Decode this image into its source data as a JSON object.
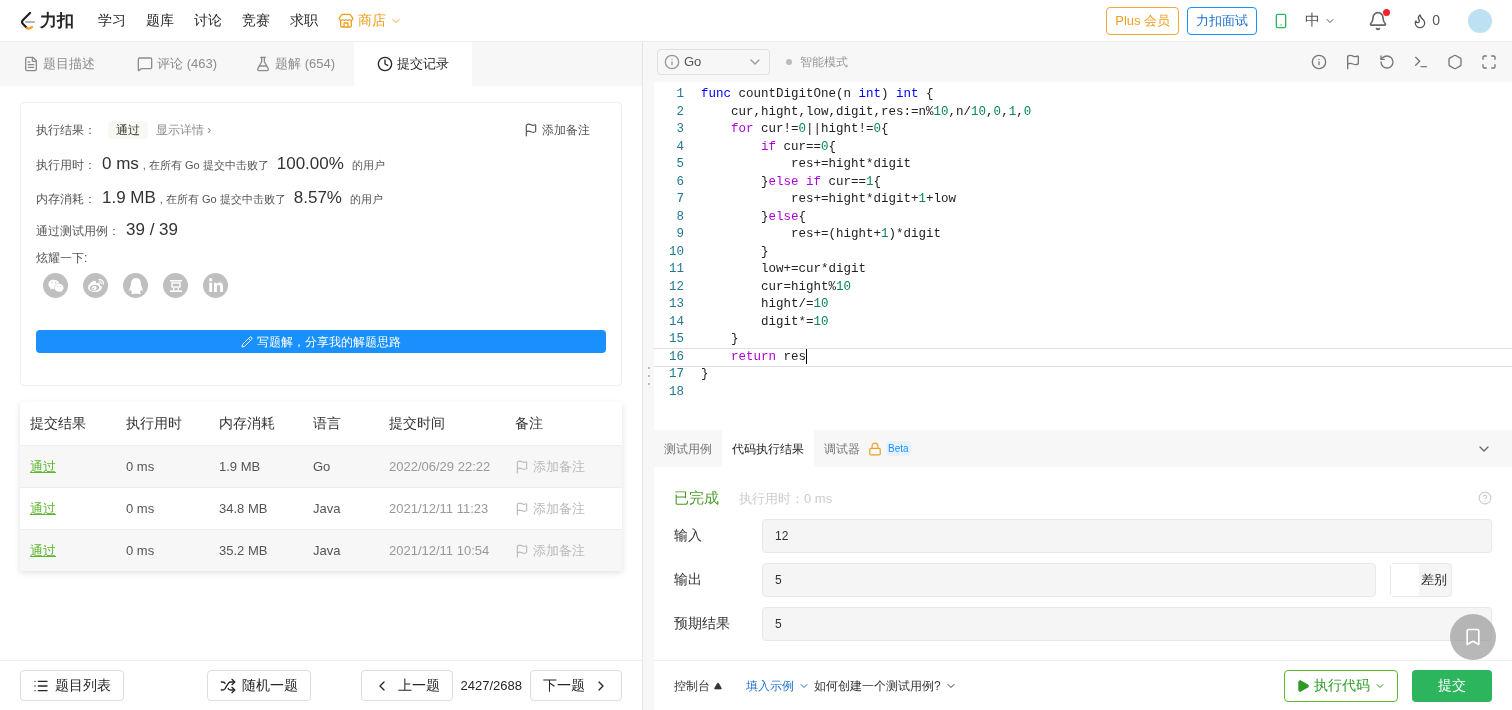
{
  "nav": {
    "logo": "力扣",
    "items": [
      {
        "label": "学习",
        "kind": "link"
      },
      {
        "label": "题库",
        "kind": "link"
      },
      {
        "label": "讨论",
        "kind": "link"
      },
      {
        "label": "竞赛",
        "kind": "link"
      },
      {
        "label": "求职",
        "kind": "link"
      },
      {
        "label": "商店",
        "kind": "store"
      }
    ],
    "plus": "Plus 会员",
    "interview": "力扣面试",
    "language": "中",
    "notification_dot": true,
    "points": "0"
  },
  "left_tabs": [
    {
      "label": "题目描述",
      "kind": "description",
      "selected": false
    },
    {
      "label": "评论 (463)",
      "kind": "comment",
      "selected": false
    },
    {
      "label": "题解 (654)",
      "kind": "solution",
      "selected": false
    },
    {
      "label": "提交记录",
      "kind": "history",
      "selected": true
    }
  ],
  "result_card": {
    "result_label": "执行结果：",
    "result": "通过",
    "details": "显示详情 ›",
    "add_note": "添加备注",
    "stats": [
      {
        "label": "执行用时：",
        "value": "0 ms",
        "middle": ", 在所有 Go 提交中击败了",
        "percent": "100.00%",
        "suffix": "的用户"
      },
      {
        "label": "内存消耗：",
        "value": "1.9 MB",
        "middle": ", 在所有 Go 提交中击败了",
        "percent": "8.57%",
        "suffix": "的用户"
      }
    ],
    "cases_label": "通过测试用例：",
    "cases": "39 / 39",
    "share_label": "炫耀一下:",
    "share": [
      {
        "kind": "wechat"
      },
      {
        "kind": "weibo"
      },
      {
        "kind": "qq"
      },
      {
        "kind": "douban"
      },
      {
        "kind": "linkedin"
      }
    ],
    "write_button": "写题解，分享我的解题思路"
  },
  "table": {
    "columns": [
      "提交结果",
      "执行用时",
      "内存消耗",
      "语言",
      "提交时间",
      "备注"
    ],
    "rows": [
      {
        "cells": [
          "通过",
          "0 ms",
          "1.9 MB",
          "Go",
          "2022/06/29 22:22"
        ],
        "note": "添加备注"
      },
      {
        "cells": [
          "通过",
          "0 ms",
          "34.8 MB",
          "Java",
          "2021/12/11 11:23"
        ],
        "note": "添加备注"
      },
      {
        "cells": [
          "通过",
          "0 ms",
          "35.2 MB",
          "Java",
          "2021/12/11 10:54"
        ],
        "note": "添加备注"
      }
    ]
  },
  "footer_left": {
    "list": "题目列表",
    "random": "随机一题",
    "prev": "上一题",
    "counter": "2427/2688",
    "next": "下一题"
  },
  "editor": {
    "language": "Go",
    "smart_mode": "智能模式",
    "lines": [
      {
        "number": "1",
        "current": false,
        "tokens": [
          {
            "kind": "kw",
            "text": "func"
          },
          {
            "kind": "plain",
            "text": " countDigitOne(n "
          },
          {
            "kind": "kw",
            "text": "int"
          },
          {
            "kind": "plain",
            "text": ") "
          },
          {
            "kind": "kw",
            "text": "int"
          },
          {
            "kind": "plain",
            "text": " {"
          }
        ]
      },
      {
        "number": "2",
        "current": false,
        "tokens": [
          {
            "kind": "plain",
            "text": "    cur,hight,low,digit,res:=n%"
          },
          {
            "kind": "num",
            "text": "10"
          },
          {
            "kind": "plain",
            "text": ",n/"
          },
          {
            "kind": "num",
            "text": "10"
          },
          {
            "kind": "plain",
            "text": ","
          },
          {
            "kind": "num",
            "text": "0"
          },
          {
            "kind": "plain",
            "text": ","
          },
          {
            "kind": "num",
            "text": "1"
          },
          {
            "kind": "plain",
            "text": ","
          },
          {
            "kind": "num",
            "text": "0"
          }
        ]
      },
      {
        "number": "3",
        "current": false,
        "tokens": [
          {
            "kind": "ctrl",
            "text": "    for"
          },
          {
            "kind": "plain",
            "text": " cur!="
          },
          {
            "kind": "num",
            "text": "0"
          },
          {
            "kind": "plain",
            "text": "||hight!="
          },
          {
            "kind": "num",
            "text": "0"
          },
          {
            "kind": "plain",
            "text": "{"
          }
        ]
      },
      {
        "number": "4",
        "current": false,
        "tokens": [
          {
            "kind": "ctrl",
            "text": "        if"
          },
          {
            "kind": "plain",
            "text": " cur=="
          },
          {
            "kind": "num",
            "text": "0"
          },
          {
            "kind": "plain",
            "text": "{"
          }
        ]
      },
      {
        "number": "5",
        "current": false,
        "tokens": [
          {
            "kind": "plain",
            "text": "            res+=hight*digit"
          }
        ]
      },
      {
        "number": "6",
        "current": false,
        "tokens": [
          {
            "kind": "plain",
            "text": "        }"
          },
          {
            "kind": "ctrl",
            "text": "else if"
          },
          {
            "kind": "plain",
            "text": " cur=="
          },
          {
            "kind": "num",
            "text": "1"
          },
          {
            "kind": "plain",
            "text": "{"
          }
        ]
      },
      {
        "number": "7",
        "current": false,
        "tokens": [
          {
            "kind": "plain",
            "text": "            res+=hight*digit+"
          },
          {
            "kind": "num",
            "text": "1"
          },
          {
            "kind": "plain",
            "text": "+low"
          }
        ]
      },
      {
        "number": "8",
        "current": false,
        "tokens": [
          {
            "kind": "plain",
            "text": "        }"
          },
          {
            "kind": "ctrl",
            "text": "else"
          },
          {
            "kind": "plain",
            "text": "{"
          }
        ]
      },
      {
        "number": "9",
        "current": false,
        "tokens": [
          {
            "kind": "plain",
            "text": "            res+=(hight+"
          },
          {
            "kind": "num",
            "text": "1"
          },
          {
            "kind": "plain",
            "text": ")*digit"
          }
        ]
      },
      {
        "number": "10",
        "current": false,
        "tokens": [
          {
            "kind": "plain",
            "text": "        }"
          }
        ]
      },
      {
        "number": "11",
        "current": false,
        "tokens": [
          {
            "kind": "plain",
            "text": "        low+=cur*digit"
          }
        ]
      },
      {
        "number": "12",
        "current": false,
        "tokens": [
          {
            "kind": "plain",
            "text": "        cur=hight%"
          },
          {
            "kind": "num",
            "text": "10"
          }
        ]
      },
      {
        "number": "13",
        "current": false,
        "tokens": [
          {
            "kind": "plain",
            "text": "        hight/="
          },
          {
            "kind": "num",
            "text": "10"
          }
        ]
      },
      {
        "number": "14",
        "current": false,
        "tokens": [
          {
            "kind": "plain",
            "text": "        digit*="
          },
          {
            "kind": "num",
            "text": "10"
          }
        ]
      },
      {
        "number": "15",
        "current": false,
        "tokens": [
          {
            "kind": "plain",
            "text": "    }"
          }
        ]
      },
      {
        "number": "16",
        "current": true,
        "tokens": [
          {
            "kind": "ctrl",
            "text": "    return"
          },
          {
            "kind": "plain",
            "text": " res"
          }
        ]
      },
      {
        "number": "17",
        "current": false,
        "tokens": [
          {
            "kind": "plain",
            "text": "}"
          }
        ]
      },
      {
        "number": "18",
        "current": false
      }
    ]
  },
  "console": {
    "tabs": [
      {
        "label": "测试用例",
        "selected": false
      },
      {
        "label": "代码执行结果",
        "selected": true
      },
      {
        "label": "调试器",
        "selected": false,
        "badge": "Beta"
      }
    ],
    "status": "已完成",
    "runtime": "执行用时：0 ms",
    "fields": [
      {
        "label": "输入",
        "value": "12"
      },
      {
        "label": "输出",
        "value": "5",
        "diff": "差别"
      },
      {
        "label": "预期结果",
        "value": "5"
      }
    ]
  },
  "footer_right": {
    "console": "控制台",
    "fill_example": "填入示例",
    "how_to": "如何创建一个测试用例?",
    "run": "执行代码",
    "submit": "提交"
  }
}
